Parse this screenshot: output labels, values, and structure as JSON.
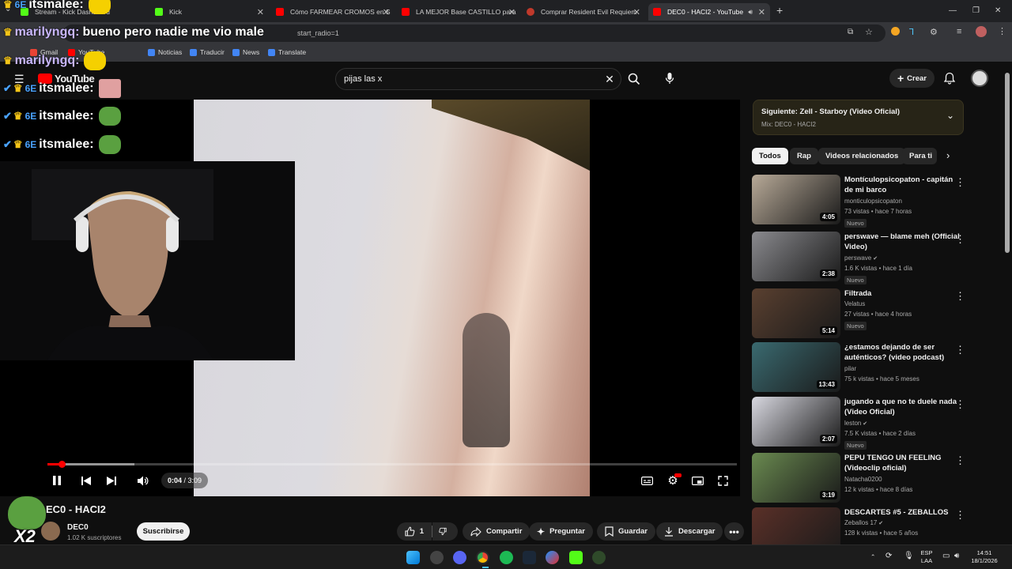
{
  "browser": {
    "tabs": [
      {
        "label": "Stream - Kick Dashboard",
        "color": "#53fc18"
      },
      {
        "label": "Kick",
        "color": "#53fc18"
      },
      {
        "label": "Cómo FARMEAR CROMOS en S",
        "color": "#ff0000"
      },
      {
        "label": "LA MEJOR Base CASTILLO para",
        "color": "#ff0000"
      },
      {
        "label": "Comprar Resident Evil Requiem",
        "color": "#c0392b"
      },
      {
        "label": "DEC0 - HACI2 - YouTube",
        "color": "#ff0000"
      }
    ],
    "url": "start_radio=1",
    "bookmarks": [
      "Gmail",
      "YouTube",
      "Noticias",
      "Traducir",
      "News",
      "Translate"
    ]
  },
  "chat_overlay": {
    "lines": [
      {
        "user": "itsmalee:",
        "badge": "6E"
      },
      {
        "user": "marilyngq:",
        "message": "bueno pero nadie me vio male"
      },
      {
        "user": "marilyngq:"
      },
      {
        "user": "itsmalee:",
        "badge": "6E"
      },
      {
        "user": "itsmalee:",
        "badge": "6E"
      },
      {
        "user": "itsmalee:",
        "badge": "6E"
      }
    ],
    "emote_label": "X2"
  },
  "youtube": {
    "logo": "YouTube",
    "search_query": "pijas las x",
    "create_label": "Crear"
  },
  "player": {
    "time_current": "0:04",
    "time_total": "3:09",
    "progress_fraction": 0.021
  },
  "video": {
    "title": "EC0 - HACI2",
    "channel": "DEC0",
    "subscribers": "1.02 K suscriptores",
    "subscribe_label": "Suscribirse",
    "likes": "1",
    "share_label": "Compartir",
    "ask_label": "Preguntar",
    "save_label": "Guardar",
    "download_label": "Descargar"
  },
  "sidebar": {
    "up_next_title": "Siguiente: Zell - Starboy (Video Oficial)",
    "up_next_mix": "Mix: DEC0 - HACI2",
    "chips": [
      "Todos",
      "Rap",
      "Videos relacionados",
      "Para ti"
    ],
    "recommendations": [
      {
        "title": "Montículopsicopaton - capitán de mi barco",
        "channel": "monticulopsicopaton",
        "meta": "73 vistas • hace 7 horas",
        "duration": "4:05",
        "new": "Nuevo",
        "verified": false,
        "bg": "#b8aa98"
      },
      {
        "title": "perswave — blame meh (Official Video)",
        "channel": "perswave",
        "meta": "1.6 K vistas • hace 1 día",
        "duration": "2:38",
        "new": "Nuevo",
        "verified": true,
        "bg": "#8a8a8e"
      },
      {
        "title": "Filtrada",
        "channel": "Velatus",
        "meta": "27 vistas • hace 4 horas",
        "duration": "5:14",
        "new": "Nuevo",
        "verified": false,
        "bg": "#5a4030"
      },
      {
        "title": "¿estamos dejando de ser auténticos? (video podcast)",
        "channel": "pilar",
        "meta": "75 k vistas • hace 5 meses",
        "duration": "13:43",
        "new": "",
        "verified": false,
        "bg": "#3a6a70"
      },
      {
        "title": "jugando a que no te duele nada (Video Oficial)",
        "channel": "leston",
        "meta": "7.5 K vistas • hace 2 días",
        "duration": "2:07",
        "new": "Nuevo",
        "verified": true,
        "bg": "#d8d8e0"
      },
      {
        "title": "PEPU   TENGO UN FEELING (Videoclip oficial)",
        "channel": "Natacha0200",
        "meta": "12 k vistas • hace 8 días",
        "duration": "3:19",
        "new": "",
        "verified": false,
        "bg": "#6a8a50"
      },
      {
        "title": "DESCARTES #5 - ZEBALLOS",
        "channel": "Zeballos 17",
        "meta": "128 k vistas • hace 5 años",
        "duration": "",
        "new": "",
        "verified": true,
        "bg": "#5a3028"
      }
    ]
  },
  "taskbar": {
    "lang_top": "ESP",
    "lang_bottom": "LAA",
    "time": "14:51",
    "date": "18/1/2026"
  }
}
